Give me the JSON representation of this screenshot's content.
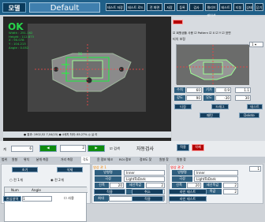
{
  "header": {
    "logo": "모델",
    "title": "Default",
    "buttons": [
      "테스트 저장",
      "테스트 로드",
      "전 화면",
      "저장",
      "등록",
      "검사",
      "캘리브레이션",
      "테스트",
      "티칭",
      "상태",
      "닫기"
    ]
  },
  "camera": {
    "status": "OK",
    "overlay_lines": [
      "Width : 251.162",
      "Height : 112.873",
      "X : 90.078",
      "Y : 104.213",
      "Angle : 0.052"
    ],
    "badge": "26",
    "bottom_text": "● 결과: 1902,52  7,04(15) ● 4세치 처리: 85.27%  ◎  실 리"
  },
  "right": {
    "checkbox_row": [
      "회원샘플 사용",
      "Pattern",
      "X",
      "Y",
      "표면"
    ],
    "title": "티치 보정",
    "rows": [
      {
        "label": "수치",
        "value": "60",
        "label2": "기가",
        "value2": "0.9",
        "value3": "1.1"
      },
      {
        "label": "강도",
        "value": "90",
        "label2": "무도",
        "value2": "-30",
        "value3": "30"
      }
    ],
    "buttons": [
      "티칭",
      "드래그",
      "테스트",
      "패턴",
      "Delete"
    ]
  },
  "camera_controls": {
    "label": "계",
    "value": "6",
    "page": "2",
    "checkbox": "검색",
    "apply": "자동검사",
    "btn1": "적용",
    "btn2": "삭제"
  },
  "tabs": [
    "범위",
    "원형",
    "위치",
    "낱개 측정",
    "거리 측정",
    "각도",
    "윤 정보 체크",
    "ROI 정보",
    "정보도 찾",
    "원형 찾",
    "원형 찾"
  ],
  "left_panel": {
    "top_buttons": [
      "초기",
      "삭제"
    ],
    "radios": [
      "전 1개",
      "전 2개"
    ],
    "table_headers": [
      "Num",
      "Angle"
    ],
    "bottom_label": "관심영역",
    "bottom_value": "1",
    "bottom_checkbox": "사용"
  },
  "mid_panel": {
    "title": "영상 관 1",
    "rows": [
      {
        "label": "방향명",
        "value": "Inner"
      },
      {
        "label": "극성",
        "value": "LightToDark"
      },
      {
        "label": "선폭",
        "value": "20",
        "label2": "세선폭값",
        "value2": "2"
      },
      {
        "label": "엣지",
        "value": "20",
        "label2": "폭값",
        "value2": "2"
      },
      {
        "label": "최소",
        "value": "50.000"
      },
      {
        "label": "최대",
        "value": "100.000"
      }
    ],
    "buttons": [
      "적용",
      "취소",
      "라인 테스트",
      "적용",
      "라인 테스트"
    ]
  },
  "right_panel2": {
    "title": "영상 관 2",
    "rows": [
      {
        "label": "방향명",
        "value": "Inner"
      },
      {
        "label": "극성",
        "value": "LightToDark"
      },
      {
        "label": "선폭",
        "value": "20",
        "label2": "세선폭값",
        "value2": "2"
      },
      {
        "label": "엣지",
        "value": "20",
        "label2": "폭값",
        "value2": "2"
      }
    ],
    "side_value": "1"
  },
  "colors": {
    "header_bg": "#1f5f88",
    "button_bg": "#163f5e",
    "accent_red": "#b30000",
    "ok_green": "#27d34b"
  }
}
